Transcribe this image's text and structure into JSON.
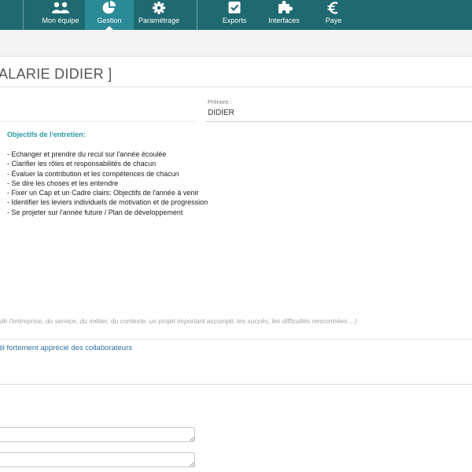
{
  "nav": {
    "items": [
      {
        "label": "Mon équipe",
        "icon": "team-icon"
      },
      {
        "label": "Gestion",
        "icon": "pie-chart-icon",
        "active": true
      },
      {
        "label": "Paramétrage",
        "icon": "gear-icon"
      },
      {
        "label": "Exports",
        "icon": "checkbox-icon"
      },
      {
        "label": "Interfaces",
        "icon": "puzzle-icon"
      },
      {
        "label": "Paye",
        "icon": "euro-icon"
      }
    ],
    "bar_color": "#1f6a70",
    "active_color": "#2a8a95"
  },
  "page": {
    "title": "ALARIE DIDIER ]"
  },
  "form": {
    "prenom_label": "Prénom :",
    "prenom_value": "DIDIER"
  },
  "objectives": {
    "title": "Objectifs de l'entretien:",
    "items": [
      "- Echanger et prendre du recul sur l'année écoulée",
      "- Clarifier les rôles et responsabilités de chacun",
      "- Évaluer la contribution et les compétences de chacun",
      "- Se dire les choses et les entendre",
      "- Fixer un Cap et un Cadre clairs: Objectifs de l'année à venir",
      "- Identifier les leviers individuels de motivation et de progression",
      "- Se projeter sur l'année future / Plan de développement"
    ]
  },
  "notes": {
    "placeholder": "de l'entreprise, du service, du métier, du contexte, un projet important accompli, les succès, les difficultés rencontrées ...)",
    "criteria_link": "til fortement apprécié des collaborateurs"
  }
}
